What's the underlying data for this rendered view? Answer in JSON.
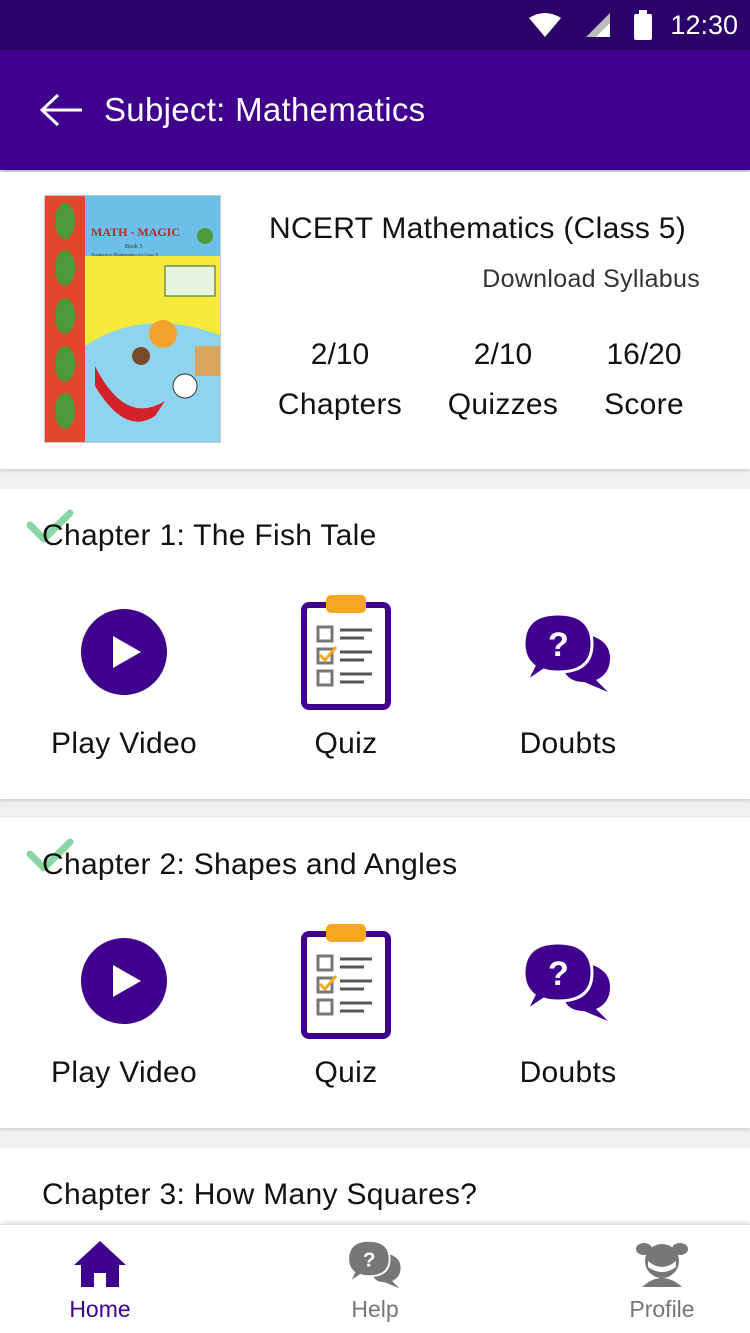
{
  "status_bar": {
    "time": "12:30"
  },
  "header": {
    "title": "Subject: Mathematics"
  },
  "book": {
    "title": "NCERT Mathematics (Class 5)",
    "download_label": "Download Syllabus",
    "cover": {
      "title": "MATH - MAGIC",
      "book_number": "Book 5",
      "subtitle": "Textbook in Mathematics for Class V"
    }
  },
  "stats": [
    {
      "value": "2/10",
      "label": "Chapters"
    },
    {
      "value": "2/10",
      "label": "Quizzes"
    },
    {
      "value": "16/20",
      "label": "Score"
    }
  ],
  "chapters": [
    {
      "title": "Chapter 1: The Fish Tale",
      "completed": true
    },
    {
      "title": "Chapter 2: Shapes and Angles",
      "completed": true
    },
    {
      "title": "Chapter 3: How Many Squares?",
      "completed": false
    }
  ],
  "actions": {
    "play": "Play Video",
    "quiz": "Quiz",
    "doubts": "Doubts"
  },
  "nav": {
    "home": "Home",
    "help": "Help",
    "profile": "Profile"
  },
  "colors": {
    "status_bar": "#2c0069",
    "app_bar": "#3f008e",
    "accent": "#3f008e",
    "clipboard_clip": "#f5a623",
    "check": "#7ed09a",
    "nav_inactive": "#777777"
  }
}
